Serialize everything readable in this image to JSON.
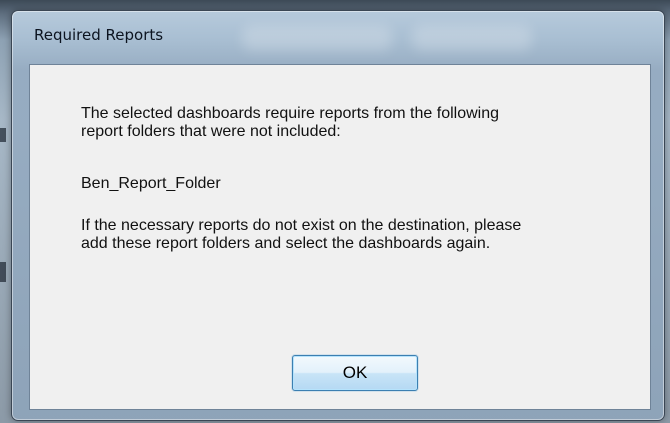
{
  "dialog": {
    "title": "Required Reports",
    "message_line1": "The selected dashboards require reports from the following\nreport folders that were not included:",
    "folder_name": "Ben_Report_Folder",
    "message_line2": "If the necessary reports do not exist on the destination, please\nadd these report folders and select the dashboards again.",
    "ok_label": "OK"
  },
  "colors": {
    "client_background": "#f0f0f0",
    "button_border": "#3c7fb1",
    "frame_glass": "#a7b8c7"
  }
}
